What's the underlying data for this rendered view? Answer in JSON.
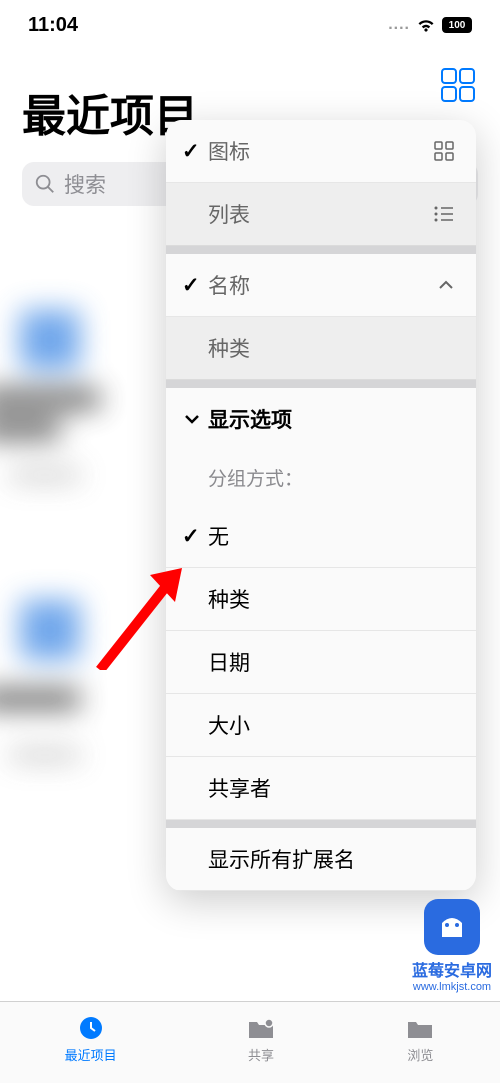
{
  "status": {
    "time": "11:04",
    "battery": "100"
  },
  "header": {
    "title": "最近项目"
  },
  "search": {
    "placeholder": "搜索"
  },
  "menu": {
    "view": {
      "icon": {
        "label": "图标",
        "checked": true
      },
      "list": {
        "label": "列表",
        "checked": false
      }
    },
    "sort": {
      "name": {
        "label": "名称",
        "checked": true
      },
      "kind": {
        "label": "种类",
        "checked": false
      }
    },
    "options": {
      "header": "显示选项",
      "group_label": "分组方式：",
      "items": {
        "none": {
          "label": "无",
          "checked": true
        },
        "kind": {
          "label": "种类",
          "checked": false
        },
        "date": {
          "label": "日期",
          "checked": false
        },
        "size": {
          "label": "大小",
          "checked": false
        },
        "shared_by": {
          "label": "共享者",
          "checked": false
        }
      },
      "show_ext": "显示所有扩展名"
    }
  },
  "tabs": {
    "recents": "最近项目",
    "shared": "共享",
    "browse": "浏览"
  },
  "watermark": {
    "name": "蓝莓安卓网",
    "url": "www.lmkjst.com"
  }
}
